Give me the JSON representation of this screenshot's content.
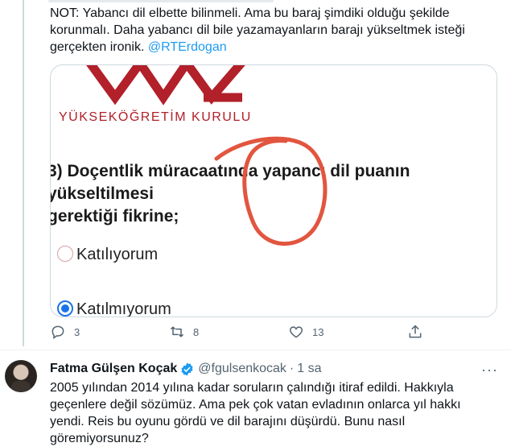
{
  "tweet1": {
    "text_lines": [
      "NOT: Yabancı dil elbette bilinmeli. Ama bu baraj şimdiki olduğu şekilde",
      "korunmalı. Daha yabancı dil bile yazamayanların barajı yükseltmek isteği",
      "gerçekten ironik. "
    ],
    "mention": "@RTErdogan",
    "image": {
      "logo_text": "YÜKSEKÖĞRETİM KURULU",
      "question_line1": "3) Doçentlik müracaatında yapancı dil puanın yükseltilmesi",
      "question_line2": "gerektiği fikrine;",
      "options": [
        {
          "label": "Katılıyorum",
          "selected": false
        },
        {
          "label": "Katılmıyorum",
          "selected": true
        }
      ],
      "colors": {
        "logo_red": "#b2202a",
        "annotation_red": "#e2553f",
        "radio_blue": "#1a73e8"
      }
    },
    "actions": {
      "reply": {
        "icon": "reply-icon",
        "count": "3"
      },
      "retweet": {
        "icon": "retweet-icon",
        "count": "8"
      },
      "like": {
        "icon": "heart-icon",
        "count": "13"
      },
      "share": {
        "icon": "share-icon"
      }
    }
  },
  "tweet2": {
    "name": "Fatma Gülşen Koçak",
    "handle": "@fgulsenkocak",
    "separator": "·",
    "time": "1 sa",
    "more": "···",
    "text_lines": [
      "2005 yılından 2014 yılına kadar soruların çalındığı itiraf edildi. Hakkıyla",
      "geçenlere değil sözümüz. Ama pek çok vatan evladının onlarca yıl hakkı",
      "yendi. Reis bu oyunu gördü ve dil barajını düşürdü. Bunu nasıl",
      "göremiyorsunuz?"
    ]
  },
  "theme": {
    "text": "#0f1419",
    "muted": "#536471",
    "link": "#1d9bf0",
    "border": "#cfd9de"
  }
}
